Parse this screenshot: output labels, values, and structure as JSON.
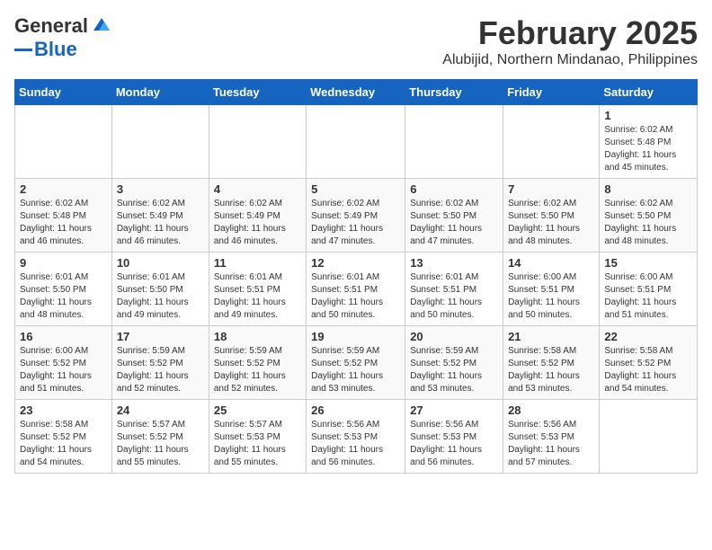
{
  "logo": {
    "part1": "General",
    "part2": "Blue"
  },
  "title": "February 2025",
  "location": "Alubijid, Northern Mindanao, Philippines",
  "weekdays": [
    "Sunday",
    "Monday",
    "Tuesday",
    "Wednesday",
    "Thursday",
    "Friday",
    "Saturday"
  ],
  "weeks": [
    [
      {
        "day": "",
        "info": ""
      },
      {
        "day": "",
        "info": ""
      },
      {
        "day": "",
        "info": ""
      },
      {
        "day": "",
        "info": ""
      },
      {
        "day": "",
        "info": ""
      },
      {
        "day": "",
        "info": ""
      },
      {
        "day": "1",
        "info": "Sunrise: 6:02 AM\nSunset: 5:48 PM\nDaylight: 11 hours\nand 45 minutes."
      }
    ],
    [
      {
        "day": "2",
        "info": "Sunrise: 6:02 AM\nSunset: 5:48 PM\nDaylight: 11 hours\nand 46 minutes."
      },
      {
        "day": "3",
        "info": "Sunrise: 6:02 AM\nSunset: 5:49 PM\nDaylight: 11 hours\nand 46 minutes."
      },
      {
        "day": "4",
        "info": "Sunrise: 6:02 AM\nSunset: 5:49 PM\nDaylight: 11 hours\nand 46 minutes."
      },
      {
        "day": "5",
        "info": "Sunrise: 6:02 AM\nSunset: 5:49 PM\nDaylight: 11 hours\nand 47 minutes."
      },
      {
        "day": "6",
        "info": "Sunrise: 6:02 AM\nSunset: 5:50 PM\nDaylight: 11 hours\nand 47 minutes."
      },
      {
        "day": "7",
        "info": "Sunrise: 6:02 AM\nSunset: 5:50 PM\nDaylight: 11 hours\nand 48 minutes."
      },
      {
        "day": "8",
        "info": "Sunrise: 6:02 AM\nSunset: 5:50 PM\nDaylight: 11 hours\nand 48 minutes."
      }
    ],
    [
      {
        "day": "9",
        "info": "Sunrise: 6:01 AM\nSunset: 5:50 PM\nDaylight: 11 hours\nand 48 minutes."
      },
      {
        "day": "10",
        "info": "Sunrise: 6:01 AM\nSunset: 5:50 PM\nDaylight: 11 hours\nand 49 minutes."
      },
      {
        "day": "11",
        "info": "Sunrise: 6:01 AM\nSunset: 5:51 PM\nDaylight: 11 hours\nand 49 minutes."
      },
      {
        "day": "12",
        "info": "Sunrise: 6:01 AM\nSunset: 5:51 PM\nDaylight: 11 hours\nand 50 minutes."
      },
      {
        "day": "13",
        "info": "Sunrise: 6:01 AM\nSunset: 5:51 PM\nDaylight: 11 hours\nand 50 minutes."
      },
      {
        "day": "14",
        "info": "Sunrise: 6:00 AM\nSunset: 5:51 PM\nDaylight: 11 hours\nand 50 minutes."
      },
      {
        "day": "15",
        "info": "Sunrise: 6:00 AM\nSunset: 5:51 PM\nDaylight: 11 hours\nand 51 minutes."
      }
    ],
    [
      {
        "day": "16",
        "info": "Sunrise: 6:00 AM\nSunset: 5:52 PM\nDaylight: 11 hours\nand 51 minutes."
      },
      {
        "day": "17",
        "info": "Sunrise: 5:59 AM\nSunset: 5:52 PM\nDaylight: 11 hours\nand 52 minutes."
      },
      {
        "day": "18",
        "info": "Sunrise: 5:59 AM\nSunset: 5:52 PM\nDaylight: 11 hours\nand 52 minutes."
      },
      {
        "day": "19",
        "info": "Sunrise: 5:59 AM\nSunset: 5:52 PM\nDaylight: 11 hours\nand 53 minutes."
      },
      {
        "day": "20",
        "info": "Sunrise: 5:59 AM\nSunset: 5:52 PM\nDaylight: 11 hours\nand 53 minutes."
      },
      {
        "day": "21",
        "info": "Sunrise: 5:58 AM\nSunset: 5:52 PM\nDaylight: 11 hours\nand 53 minutes."
      },
      {
        "day": "22",
        "info": "Sunrise: 5:58 AM\nSunset: 5:52 PM\nDaylight: 11 hours\nand 54 minutes."
      }
    ],
    [
      {
        "day": "23",
        "info": "Sunrise: 5:58 AM\nSunset: 5:52 PM\nDaylight: 11 hours\nand 54 minutes."
      },
      {
        "day": "24",
        "info": "Sunrise: 5:57 AM\nSunset: 5:52 PM\nDaylight: 11 hours\nand 55 minutes."
      },
      {
        "day": "25",
        "info": "Sunrise: 5:57 AM\nSunset: 5:53 PM\nDaylight: 11 hours\nand 55 minutes."
      },
      {
        "day": "26",
        "info": "Sunrise: 5:56 AM\nSunset: 5:53 PM\nDaylight: 11 hours\nand 56 minutes."
      },
      {
        "day": "27",
        "info": "Sunrise: 5:56 AM\nSunset: 5:53 PM\nDaylight: 11 hours\nand 56 minutes."
      },
      {
        "day": "28",
        "info": "Sunrise: 5:56 AM\nSunset: 5:53 PM\nDaylight: 11 hours\nand 57 minutes."
      },
      {
        "day": "",
        "info": ""
      }
    ]
  ]
}
